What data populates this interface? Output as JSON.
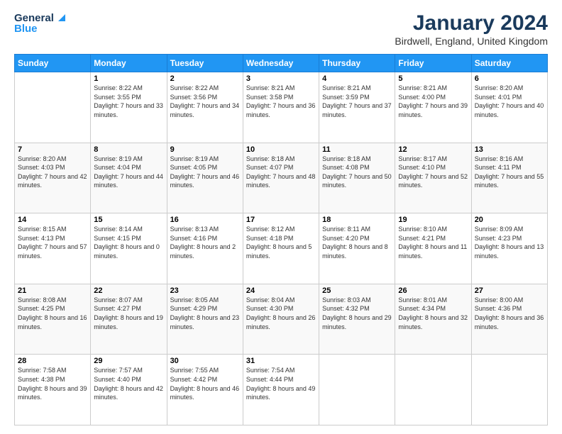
{
  "header": {
    "logo_line1": "General",
    "logo_line2": "Blue",
    "title": "January 2024",
    "location": "Birdwell, England, United Kingdom"
  },
  "days_of_week": [
    "Sunday",
    "Monday",
    "Tuesday",
    "Wednesday",
    "Thursday",
    "Friday",
    "Saturday"
  ],
  "weeks": [
    [
      {
        "day": "",
        "sunrise": "",
        "sunset": "",
        "daylight": ""
      },
      {
        "day": "1",
        "sunrise": "Sunrise: 8:22 AM",
        "sunset": "Sunset: 3:55 PM",
        "daylight": "Daylight: 7 hours and 33 minutes."
      },
      {
        "day": "2",
        "sunrise": "Sunrise: 8:22 AM",
        "sunset": "Sunset: 3:56 PM",
        "daylight": "Daylight: 7 hours and 34 minutes."
      },
      {
        "day": "3",
        "sunrise": "Sunrise: 8:21 AM",
        "sunset": "Sunset: 3:58 PM",
        "daylight": "Daylight: 7 hours and 36 minutes."
      },
      {
        "day": "4",
        "sunrise": "Sunrise: 8:21 AM",
        "sunset": "Sunset: 3:59 PM",
        "daylight": "Daylight: 7 hours and 37 minutes."
      },
      {
        "day": "5",
        "sunrise": "Sunrise: 8:21 AM",
        "sunset": "Sunset: 4:00 PM",
        "daylight": "Daylight: 7 hours and 39 minutes."
      },
      {
        "day": "6",
        "sunrise": "Sunrise: 8:20 AM",
        "sunset": "Sunset: 4:01 PM",
        "daylight": "Daylight: 7 hours and 40 minutes."
      }
    ],
    [
      {
        "day": "7",
        "sunrise": "Sunrise: 8:20 AM",
        "sunset": "Sunset: 4:03 PM",
        "daylight": "Daylight: 7 hours and 42 minutes."
      },
      {
        "day": "8",
        "sunrise": "Sunrise: 8:19 AM",
        "sunset": "Sunset: 4:04 PM",
        "daylight": "Daylight: 7 hours and 44 minutes."
      },
      {
        "day": "9",
        "sunrise": "Sunrise: 8:19 AM",
        "sunset": "Sunset: 4:05 PM",
        "daylight": "Daylight: 7 hours and 46 minutes."
      },
      {
        "day": "10",
        "sunrise": "Sunrise: 8:18 AM",
        "sunset": "Sunset: 4:07 PM",
        "daylight": "Daylight: 7 hours and 48 minutes."
      },
      {
        "day": "11",
        "sunrise": "Sunrise: 8:18 AM",
        "sunset": "Sunset: 4:08 PM",
        "daylight": "Daylight: 7 hours and 50 minutes."
      },
      {
        "day": "12",
        "sunrise": "Sunrise: 8:17 AM",
        "sunset": "Sunset: 4:10 PM",
        "daylight": "Daylight: 7 hours and 52 minutes."
      },
      {
        "day": "13",
        "sunrise": "Sunrise: 8:16 AM",
        "sunset": "Sunset: 4:11 PM",
        "daylight": "Daylight: 7 hours and 55 minutes."
      }
    ],
    [
      {
        "day": "14",
        "sunrise": "Sunrise: 8:15 AM",
        "sunset": "Sunset: 4:13 PM",
        "daylight": "Daylight: 7 hours and 57 minutes."
      },
      {
        "day": "15",
        "sunrise": "Sunrise: 8:14 AM",
        "sunset": "Sunset: 4:15 PM",
        "daylight": "Daylight: 8 hours and 0 minutes."
      },
      {
        "day": "16",
        "sunrise": "Sunrise: 8:13 AM",
        "sunset": "Sunset: 4:16 PM",
        "daylight": "Daylight: 8 hours and 2 minutes."
      },
      {
        "day": "17",
        "sunrise": "Sunrise: 8:12 AM",
        "sunset": "Sunset: 4:18 PM",
        "daylight": "Daylight: 8 hours and 5 minutes."
      },
      {
        "day": "18",
        "sunrise": "Sunrise: 8:11 AM",
        "sunset": "Sunset: 4:20 PM",
        "daylight": "Daylight: 8 hours and 8 minutes."
      },
      {
        "day": "19",
        "sunrise": "Sunrise: 8:10 AM",
        "sunset": "Sunset: 4:21 PM",
        "daylight": "Daylight: 8 hours and 11 minutes."
      },
      {
        "day": "20",
        "sunrise": "Sunrise: 8:09 AM",
        "sunset": "Sunset: 4:23 PM",
        "daylight": "Daylight: 8 hours and 13 minutes."
      }
    ],
    [
      {
        "day": "21",
        "sunrise": "Sunrise: 8:08 AM",
        "sunset": "Sunset: 4:25 PM",
        "daylight": "Daylight: 8 hours and 16 minutes."
      },
      {
        "day": "22",
        "sunrise": "Sunrise: 8:07 AM",
        "sunset": "Sunset: 4:27 PM",
        "daylight": "Daylight: 8 hours and 19 minutes."
      },
      {
        "day": "23",
        "sunrise": "Sunrise: 8:05 AM",
        "sunset": "Sunset: 4:29 PM",
        "daylight": "Daylight: 8 hours and 23 minutes."
      },
      {
        "day": "24",
        "sunrise": "Sunrise: 8:04 AM",
        "sunset": "Sunset: 4:30 PM",
        "daylight": "Daylight: 8 hours and 26 minutes."
      },
      {
        "day": "25",
        "sunrise": "Sunrise: 8:03 AM",
        "sunset": "Sunset: 4:32 PM",
        "daylight": "Daylight: 8 hours and 29 minutes."
      },
      {
        "day": "26",
        "sunrise": "Sunrise: 8:01 AM",
        "sunset": "Sunset: 4:34 PM",
        "daylight": "Daylight: 8 hours and 32 minutes."
      },
      {
        "day": "27",
        "sunrise": "Sunrise: 8:00 AM",
        "sunset": "Sunset: 4:36 PM",
        "daylight": "Daylight: 8 hours and 36 minutes."
      }
    ],
    [
      {
        "day": "28",
        "sunrise": "Sunrise: 7:58 AM",
        "sunset": "Sunset: 4:38 PM",
        "daylight": "Daylight: 8 hours and 39 minutes."
      },
      {
        "day": "29",
        "sunrise": "Sunrise: 7:57 AM",
        "sunset": "Sunset: 4:40 PM",
        "daylight": "Daylight: 8 hours and 42 minutes."
      },
      {
        "day": "30",
        "sunrise": "Sunrise: 7:55 AM",
        "sunset": "Sunset: 4:42 PM",
        "daylight": "Daylight: 8 hours and 46 minutes."
      },
      {
        "day": "31",
        "sunrise": "Sunrise: 7:54 AM",
        "sunset": "Sunset: 4:44 PM",
        "daylight": "Daylight: 8 hours and 49 minutes."
      },
      {
        "day": "",
        "sunrise": "",
        "sunset": "",
        "daylight": ""
      },
      {
        "day": "",
        "sunrise": "",
        "sunset": "",
        "daylight": ""
      },
      {
        "day": "",
        "sunrise": "",
        "sunset": "",
        "daylight": ""
      }
    ]
  ]
}
